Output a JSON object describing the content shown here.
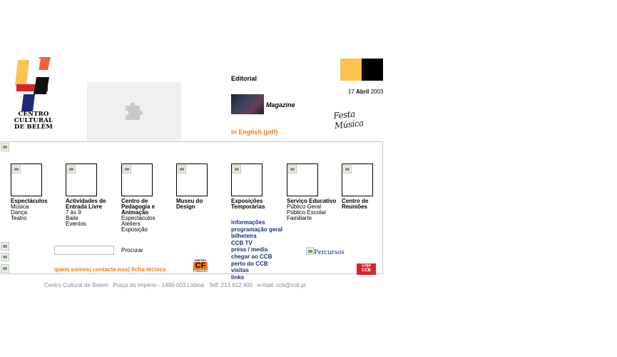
{
  "logo": {
    "lines": [
      "Centro",
      "Cultural",
      "de Belém"
    ]
  },
  "header": {
    "editorial": "Editorial",
    "date_day": "17",
    "date_month": "Abril",
    "date_year": "2003",
    "magazine": "Magazine",
    "english_link": "In English (pdf)",
    "festa_logo": "Festa Música"
  },
  "colors": {
    "accent_orange": "#f47a10",
    "yellow_square": "#fdc24f",
    "link_blue": "#1a2f7c",
    "divider": "#c6c6c6"
  },
  "sections": [
    {
      "title": "Espectáculos",
      "subs": [
        "Música",
        "Dança",
        "Teatro"
      ]
    },
    {
      "title": "Actividades de Entrada Livre",
      "subs": [
        "7 às 9",
        "Baile",
        "Eventos"
      ]
    },
    {
      "title": "Centro de Pedagogia e Animação",
      "subs": [
        "Espectáculos",
        "Ateliers",
        "Exposição"
      ]
    },
    {
      "title": "Museu do Design",
      "subs": []
    },
    {
      "title": "Exposições Temporárias",
      "subs": []
    },
    {
      "title": "Serviço Educativo",
      "subs": [
        "Público Geral",
        "Público Escolar",
        "Familiarte"
      ]
    },
    {
      "title": "Centro de Reuniões",
      "subs": []
    }
  ],
  "info_links": [
    "informações",
    "programação geral",
    "bilheteira",
    "CCB TV",
    "press / media",
    "chegar ao CCB",
    "perto do CCB",
    "visitas",
    "links"
  ],
  "search": {
    "button": "Procurar",
    "value": ""
  },
  "percursos": "Percursos",
  "cf_logo": {
    "top": "CENTRO",
    "letters": "CF",
    "bottom": "FORMAÇÃO"
  },
  "loja_logo": {
    "top": "Loja",
    "bottom": "CCB"
  },
  "bottom_links": [
    "quem somos",
    "contacte-nos",
    "ficha técnica"
  ],
  "footer": {
    "name": "Centro Cultural de Belém",
    "address": "Praça do Império - 1499-003 Lisboa",
    "phone": "Telf: 213 612 400",
    "email": "e-mail: ccb@ccb.pt"
  }
}
